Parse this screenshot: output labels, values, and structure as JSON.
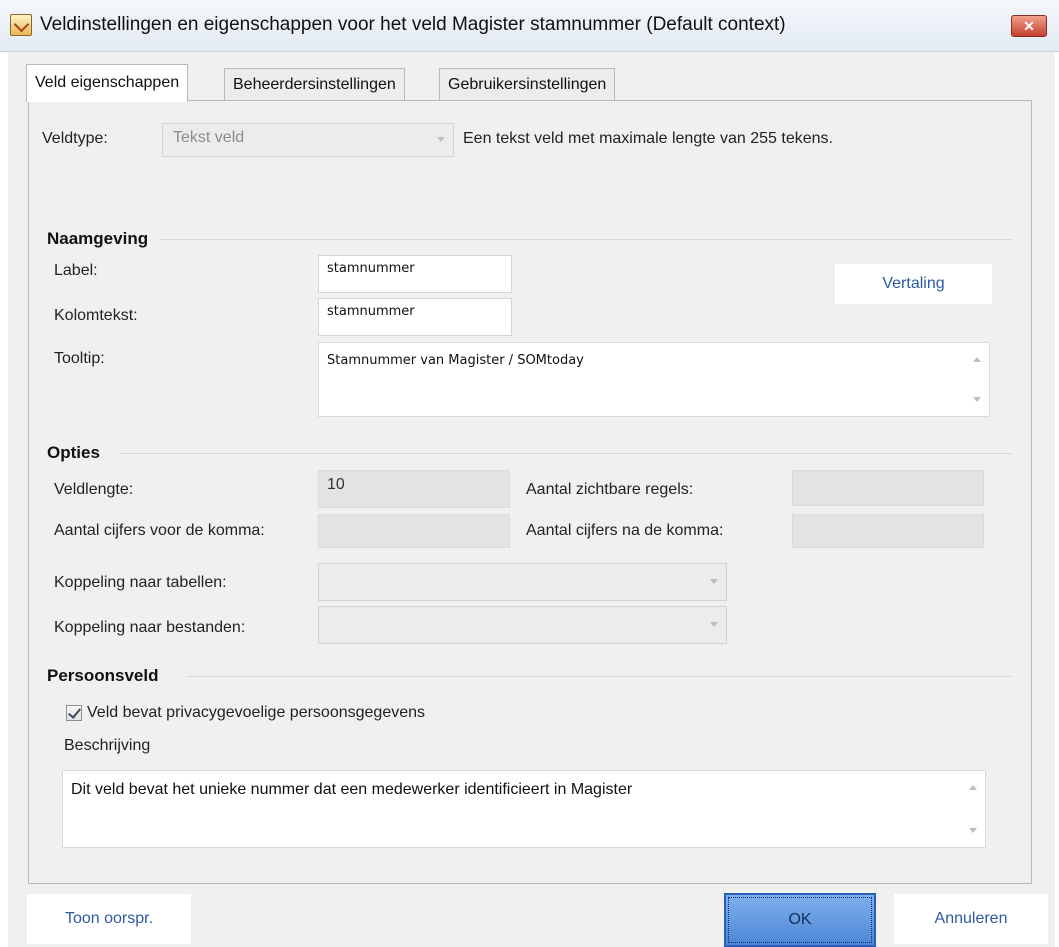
{
  "window": {
    "title": "Veldinstellingen en eigenschappen voor het veld Magister stamnummer (Default context)",
    "close_glyph": "✕"
  },
  "tabs": [
    {
      "label": "Veld eigenschappen",
      "active": true
    },
    {
      "label": "Beheerdersinstellingen",
      "active": false
    },
    {
      "label": "Gebruikersinstellingen",
      "active": false
    }
  ],
  "veldtype": {
    "label": "Veldtype:",
    "value": "Tekst veld",
    "description": "Een tekst veld met maximale lengte van 255 tekens."
  },
  "naamgeving": {
    "heading": "Naamgeving",
    "label_label": "Label:",
    "label_value": "stamnummer",
    "kolomtekst_label": "Kolomtekst:",
    "kolomtekst_value": "stamnummer",
    "tooltip_label": "Tooltip:",
    "tooltip_value": "Stamnummer van Magister / SOMtoday",
    "vertaling_button": "Vertaling"
  },
  "opties": {
    "heading": "Opties",
    "veldlengte_label": "Veldlengte:",
    "veldlengte_value": "10",
    "zichtbare_regels_label": "Aantal zichtbare regels:",
    "zichtbare_regels_value": "",
    "cijfers_voor_label": "Aantal cijfers voor de komma:",
    "cijfers_voor_value": "",
    "cijfers_na_label": "Aantal cijfers na de komma:",
    "cijfers_na_value": "",
    "koppeling_tabellen_label": "Koppeling naar tabellen:",
    "koppeling_tabellen_value": "",
    "koppeling_bestanden_label": "Koppeling naar bestanden:",
    "koppeling_bestanden_value": ""
  },
  "persoonsveld": {
    "heading": "Persoonsveld",
    "privacy_checkbox_label": "Veld bevat privacygevoelige persoonsgegevens",
    "privacy_checked": true,
    "beschrijving_label": "Beschrijving",
    "beschrijving_value": "Dit veld bevat het unieke nummer dat een medewerker identificieert in Magister"
  },
  "footer": {
    "toon_button": "Toon oorspr.",
    "ok_button": "OK",
    "annuleren_button": "Annuleren"
  },
  "colors": {
    "accent": "#2d5aa5",
    "ok_button": "#5a91df",
    "close_button": "#c5402e"
  }
}
